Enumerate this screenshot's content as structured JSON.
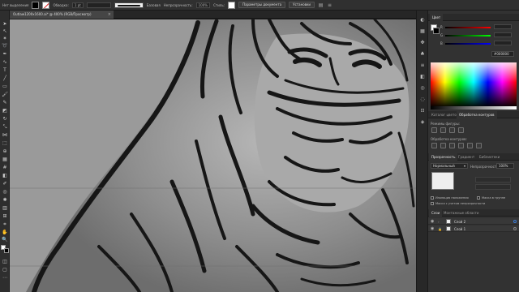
{
  "control_bar": {
    "no_selection": "Нет выделения",
    "stroke_label": "Обводка:",
    "stroke_weight": "1 pt",
    "brush_label": "Базовая",
    "opacity_label": "Непрозрачность:",
    "opacity_value": "100%",
    "style_label": "Стиль:",
    "doc_setup_button": "Параметры документа",
    "prefs_button": "Установки"
  },
  "document": {
    "tab_title": "Outlaw1200x1600.ai* @ 400% (RGB/Просмотр)",
    "close_glyph": "×"
  },
  "colors": {
    "canvas_bg": "#9a9a9a",
    "ink": "#161616",
    "accent_blue": "#3a7bd5"
  },
  "color_panel": {
    "title": "Цвет",
    "r_label": "R",
    "g_label": "G",
    "b_label": "B",
    "hex_prefix": "#",
    "hex_value": "000000"
  },
  "pathfinder": {
    "tabs": [
      "Каталог цветов",
      "Обработка контуров"
    ],
    "shape_modes_label": "Режимы фигуры:",
    "pathfinders_label": "Обработка контуров:"
  },
  "transparency": {
    "tabs": [
      "Прозрачность",
      "Градиент",
      "Библиотеки"
    ],
    "blend_mode": "Нормальный",
    "opacity_label": "Непрозрачность:",
    "opacity_value": "100%",
    "checkboxes": [
      "Изоляция наложения",
      "Маска в группе",
      "Маска с учетом непрозрачности"
    ]
  },
  "layers": {
    "tabs": [
      "Слои",
      "Монтажные области"
    ],
    "items": [
      {
        "name": "Слой 2"
      },
      {
        "name": "Слой 1"
      }
    ]
  }
}
